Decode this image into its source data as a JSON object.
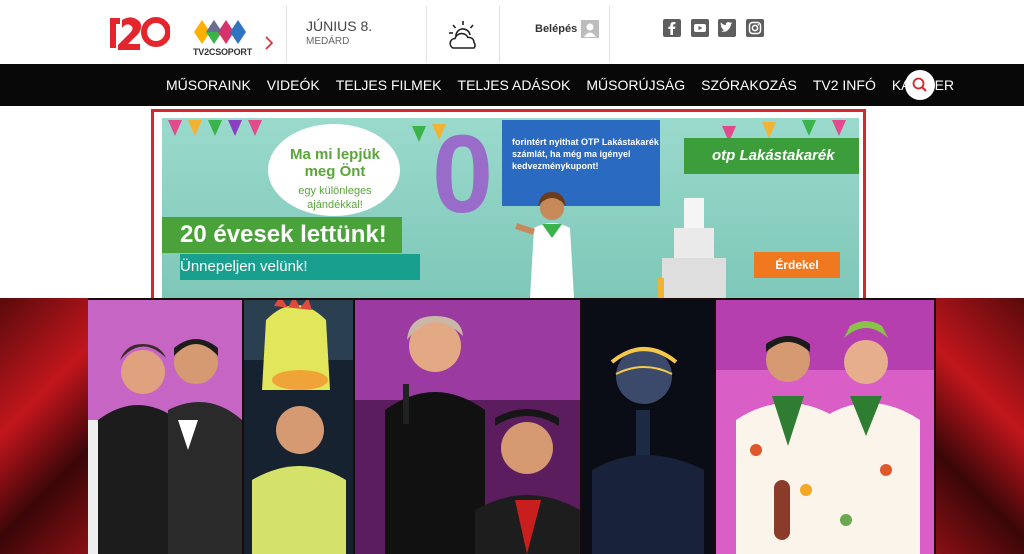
{
  "header": {
    "logo_alt": "TV2",
    "group_logo_text": "TV2CSOPORT",
    "date": "JÚNIUS 8.",
    "nameday": "MEDÁRD",
    "login_label": "Belépés"
  },
  "social": [
    "facebook-icon",
    "youtube-icon",
    "twitter-icon",
    "instagram-icon"
  ],
  "nav": {
    "items": [
      "MŰSORAINK",
      "VIDEÓK",
      "TELJES FILMEK",
      "TELJES ADÁSOK",
      "MŰSORÚJSÁG",
      "SZÓRAKOZÁS",
      "TV2 INFÓ",
      "KARRIER"
    ]
  },
  "ad": {
    "cloud_title": "Ma mi lepjük meg Önt",
    "cloud_sub": "egy különleges ajándékkal!",
    "years": "20 évesek lettünk!",
    "celebrate": "Ünnepeljen velünk!",
    "zero": "0",
    "bubble": "forintért nyithat OTP Lakástakarék számlát, ha még ma igényel kedvezménykupont!",
    "brand": "otp Lakástakarék",
    "cta": "Érdekel"
  },
  "colors": {
    "nav_bg": "#080808",
    "brand_red": "#d7262e",
    "otp_green": "#3c9e3a",
    "cta_orange": "#f0781f"
  }
}
